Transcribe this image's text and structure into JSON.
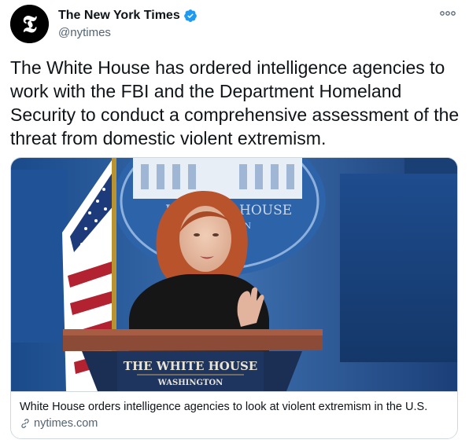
{
  "author": {
    "name": "The New York Times",
    "handle": "@nytimes",
    "avatar_glyph": "𝕿",
    "verified_icon": "verified-badge-icon"
  },
  "tweet": {
    "text": "The White House has ordered intelligence agencies to work with the FBI and the Department Homeland Security to conduct a comprehensive assessment of the threat from domestic violent extremism."
  },
  "card": {
    "title": "White House orders intelligence agencies to look at violent extremism in the U.S.",
    "domain": "nytimes.com",
    "link_icon": "link-icon",
    "image": {
      "podium_line1": "THE WHITE HOUSE",
      "podium_line2": "WASHINGTON",
      "seal_text": "HOUSE",
      "seal_text_left": "HE",
      "seal_text_small": "ON"
    }
  },
  "colors": {
    "verified_blue": "#1d9bf0",
    "text_primary": "#0f1419",
    "text_secondary": "#536471",
    "border": "#cfd9de"
  }
}
